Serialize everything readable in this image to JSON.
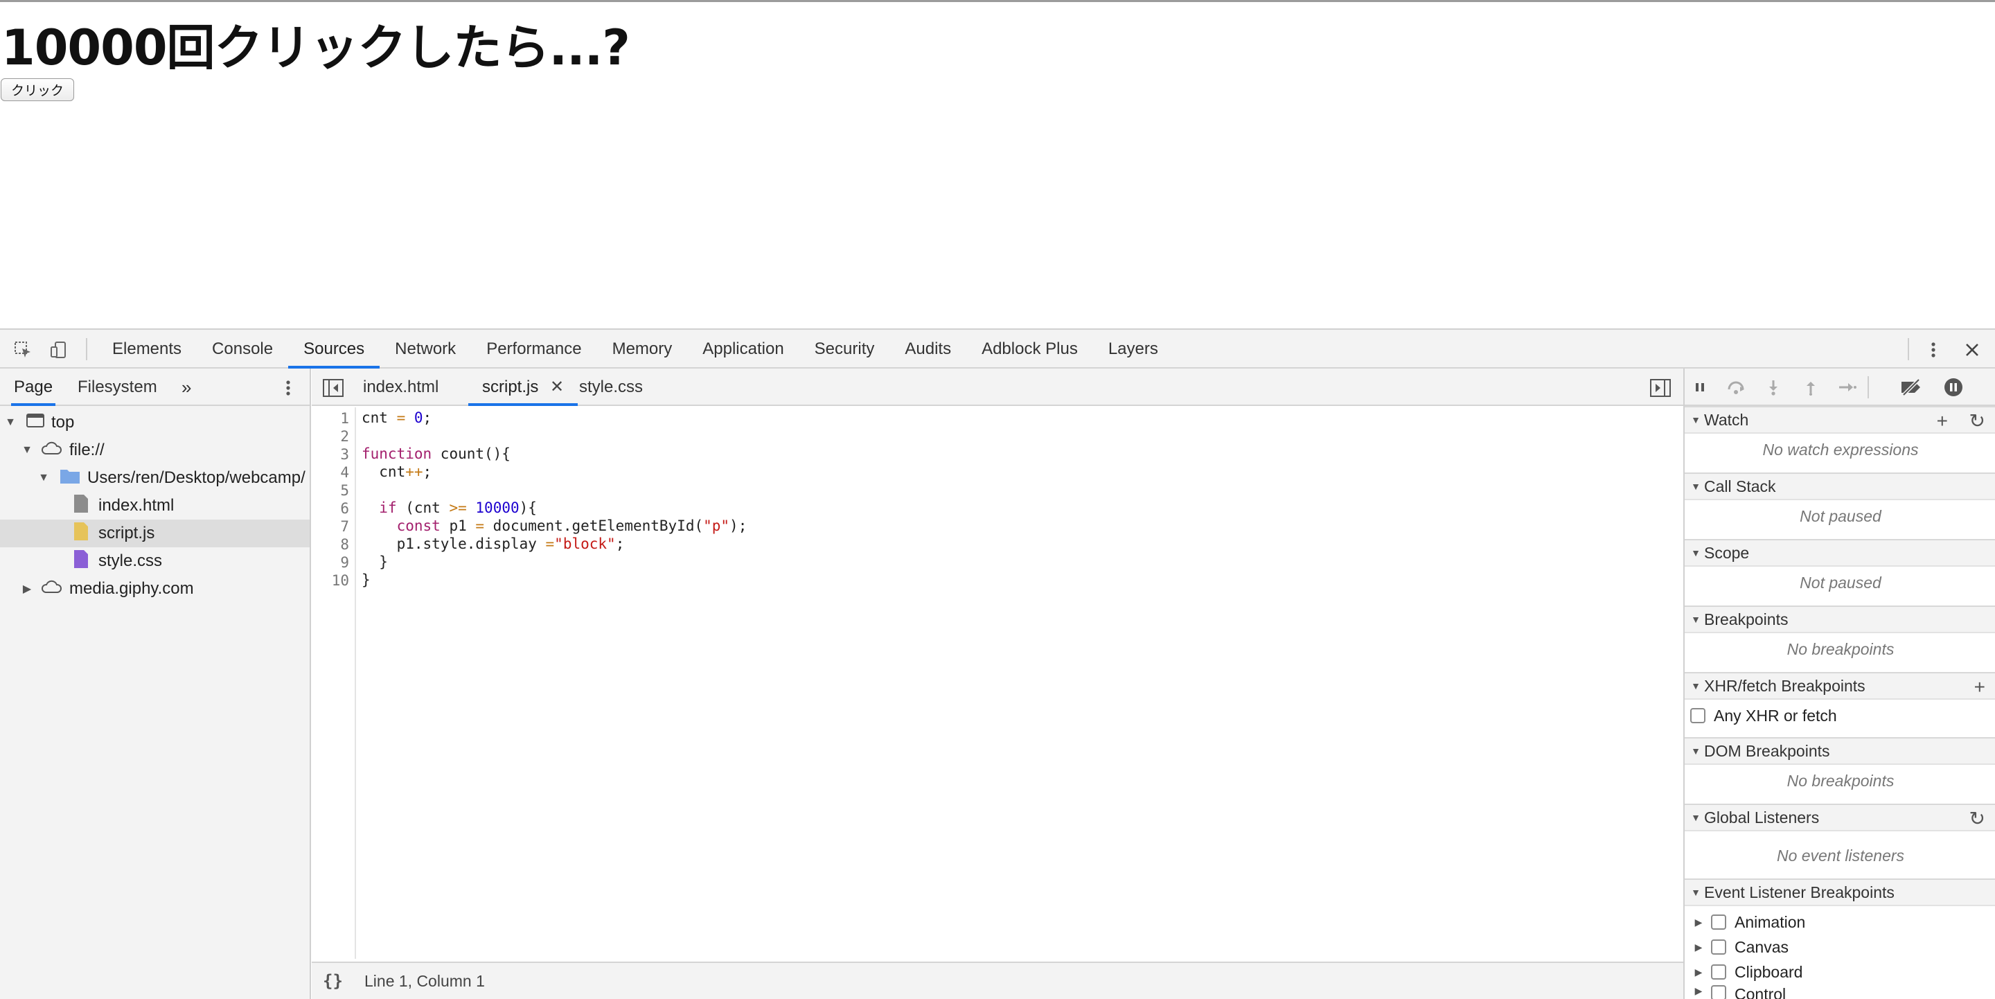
{
  "page": {
    "heading": "10000回クリックしたら...?",
    "button_label": "クリック"
  },
  "devtools": {
    "main_tabs": [
      "Elements",
      "Console",
      "Sources",
      "Network",
      "Performance",
      "Memory",
      "Application",
      "Security",
      "Audits",
      "Adblock Plus",
      "Layers"
    ],
    "active_main_tab": "Sources",
    "navigator": {
      "tabs": [
        "Page",
        "Filesystem"
      ],
      "active_tab": "Page",
      "tree": [
        {
          "label": "top",
          "icon": "frame-icon",
          "expanded": true
        },
        {
          "label": "file://",
          "icon": "cloud-icon",
          "expanded": true
        },
        {
          "label": "Users/ren/Desktop/webcamp/",
          "icon": "folder-icon",
          "expanded": true
        },
        {
          "label": "index.html",
          "icon": "file-html-icon"
        },
        {
          "label": "script.js",
          "icon": "file-js-icon",
          "selected": true
        },
        {
          "label": "style.css",
          "icon": "file-css-icon"
        },
        {
          "label": "media.giphy.com",
          "icon": "cloud-icon",
          "expanded": false
        }
      ]
    },
    "editor": {
      "tabs": [
        "index.html",
        "script.js",
        "style.css"
      ],
      "active_tab": "script.js",
      "line_numbers": [
        "1",
        "2",
        "3",
        "4",
        "5",
        "6",
        "7",
        "8",
        "9",
        "10"
      ],
      "code_lines": [
        "cnt = 0;",
        "",
        "function count(){",
        "  cnt++;",
        "",
        "  if (cnt >= 10000){",
        "    const p1 = document.getElementById(\"p\");",
        "    p1.style.display =\"block\";",
        "  }",
        "}"
      ],
      "status": "Line 1, Column 1",
      "format_label": "{}"
    },
    "debugger": {
      "sections": [
        {
          "title": "Watch",
          "empty": "No watch expressions"
        },
        {
          "title": "Call Stack",
          "empty": "Not paused"
        },
        {
          "title": "Scope",
          "empty": "Not paused"
        },
        {
          "title": "Breakpoints",
          "empty": "No breakpoints"
        },
        {
          "title": "XHR/fetch Breakpoints",
          "checkbox": "Any XHR or fetch"
        },
        {
          "title": "DOM Breakpoints",
          "empty": "No breakpoints"
        },
        {
          "title": "Global Listeners",
          "empty": "No event listeners"
        },
        {
          "title": "Event Listener Breakpoints",
          "items": [
            "Animation",
            "Canvas",
            "Clipboard",
            "Control"
          ]
        }
      ]
    },
    "colors": {
      "accent": "#1a73e8",
      "toolbar_bg": "#f3f3f3",
      "selected_row": "#dddddd",
      "keyword": "#a3206d",
      "number": "#1c00cf",
      "string": "#c41a16"
    }
  }
}
